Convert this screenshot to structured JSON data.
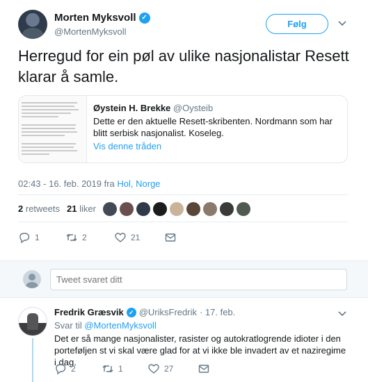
{
  "author": {
    "name": "Morten Myksvoll",
    "handle": "@MortenMyksvoll",
    "verified_glyph": "✓"
  },
  "follow_label": "Følg",
  "tweet": {
    "text": "Herregud for ein pøl av ulike nasjonalistar Resett klarar å samle.",
    "timestamp": "02:43 - 16. feb. 2019 fra ",
    "location": "Hol, Norge",
    "retweets_count": "2",
    "retweets_label": "retweets",
    "likes_count": "21",
    "likes_label": "liker",
    "actions": {
      "replies": "1",
      "retweets": "2",
      "likes": "21"
    }
  },
  "quote": {
    "name": "Øystein H. Brekke",
    "handle": "@Oysteib",
    "text": "Dette er den aktuelle Resett-skribenten. Nordmann som har blitt serbisk nasjonalist. Koseleg.",
    "link": "Vis denne tråden"
  },
  "reply_box": {
    "placeholder": "Tweet svaret ditt"
  },
  "reply": {
    "name": "Fredrik Græsvik",
    "handle": "@UriksFredrik",
    "date": "· 17. feb.",
    "reply_to_prefix": "Svar til ",
    "reply_to_handle": "@MortenMyksvoll",
    "text": "Det er så mange nasjonalister, rasister og autokratlogrende idioter i den porteføljen st vi skal være glad for at vi ikke ble invadert av et naziregime i dag.",
    "actions": {
      "replies": "2",
      "retweets": "1",
      "likes": "27"
    }
  },
  "colors": {
    "accent": "#1da1f2",
    "muted": "#657786",
    "text": "#14171a",
    "thread_line": "#a6d8f9"
  },
  "icons": [
    "verified-icon",
    "chevron-down-icon",
    "reply-icon",
    "retweet-icon",
    "heart-icon",
    "message-icon"
  ]
}
